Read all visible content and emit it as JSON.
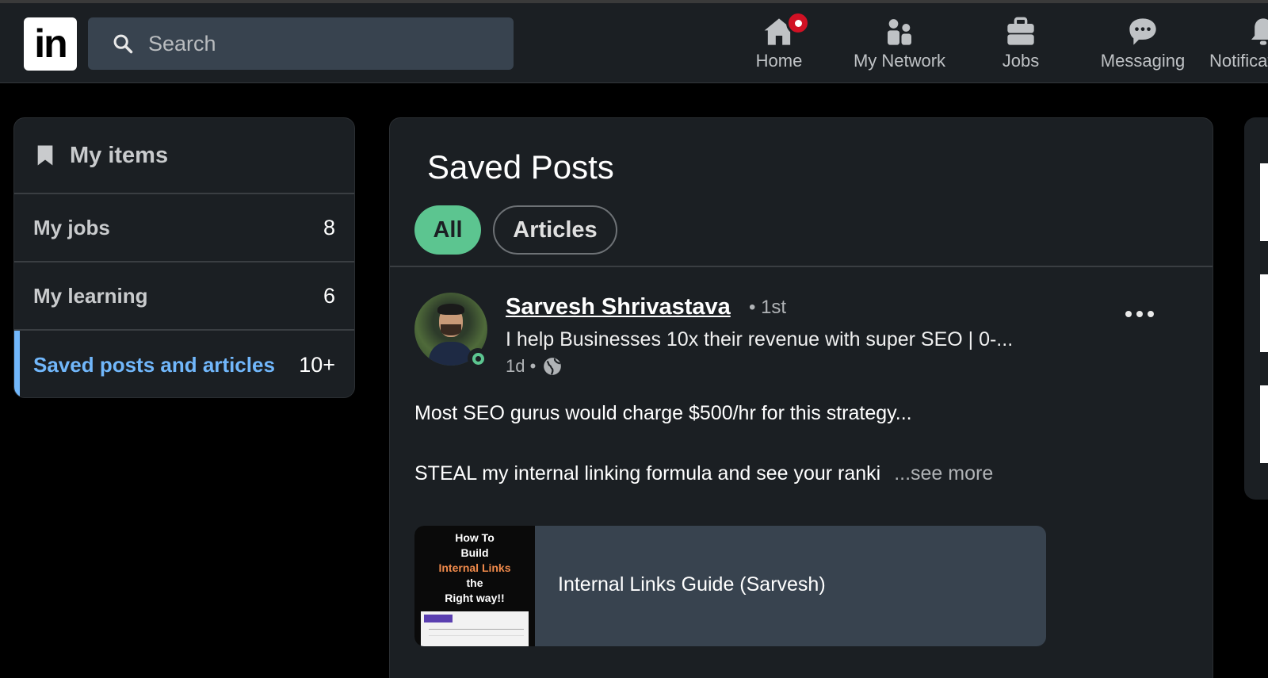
{
  "nav": {
    "logo": "in",
    "search_placeholder": "Search",
    "items": [
      {
        "label": "Home",
        "icon": "home-icon"
      },
      {
        "label": "My Network",
        "icon": "network-icon"
      },
      {
        "label": "Jobs",
        "icon": "briefcase-icon"
      },
      {
        "label": "Messaging",
        "icon": "messaging-icon"
      },
      {
        "label": "Notifications",
        "icon": "bell-icon"
      }
    ]
  },
  "sidebar": {
    "title": "My items",
    "items": [
      {
        "label": "My jobs",
        "count": "8"
      },
      {
        "label": "My learning",
        "count": "6"
      },
      {
        "label": "Saved posts and articles",
        "count": "10+"
      }
    ]
  },
  "main": {
    "title": "Saved Posts",
    "filters": [
      "All",
      "Articles"
    ],
    "post": {
      "author": "Sarvesh Shrivastava",
      "degree": "• 1st",
      "headline": "I help Businesses 10x their revenue with super SEO | 0-...",
      "time": "1d •",
      "body_line1": "Most SEO gurus would charge $500/hr for this strategy...",
      "body_line2": "STEAL my internal linking formula and see your ranki",
      "see_more": "...see more",
      "link_title": "Internal Links Guide (Sarvesh)",
      "thumb": {
        "line1": "How To",
        "line2": "Build",
        "line3": "Internal Links",
        "line4": "the",
        "line5": "Right way!!"
      }
    }
  },
  "colors": {
    "accent_green": "#5cc590",
    "accent_blue": "#71b7fb",
    "badge_red": "#d11124"
  }
}
